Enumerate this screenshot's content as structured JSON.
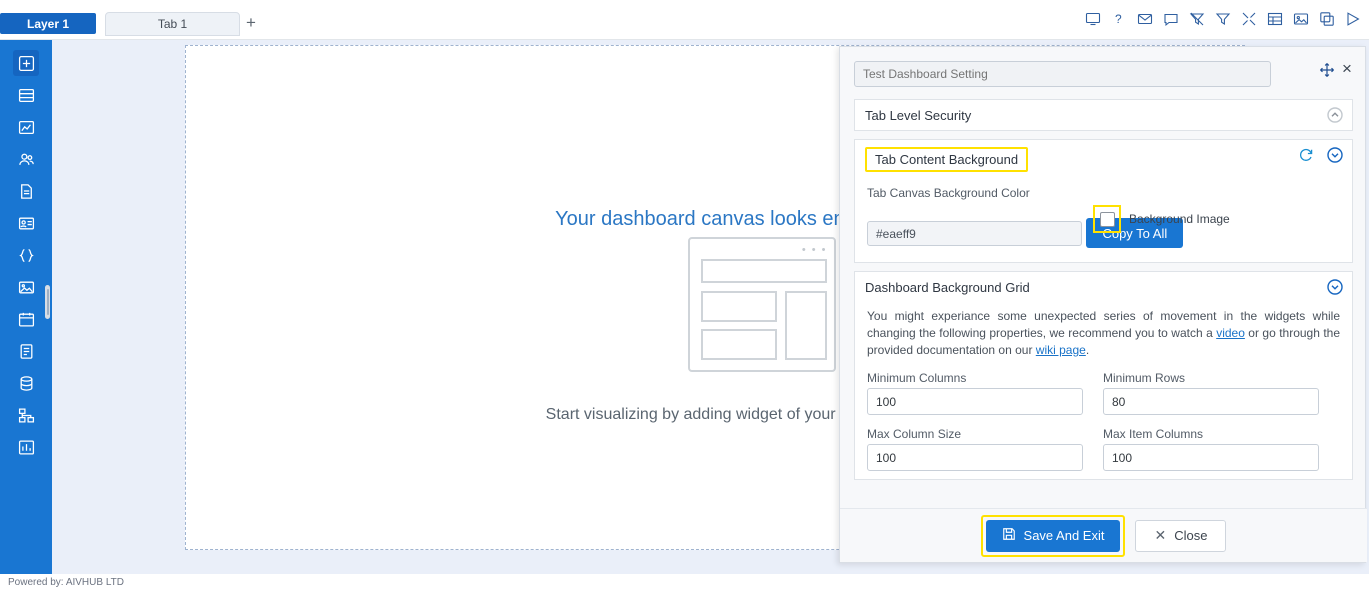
{
  "topbar": {
    "layer_label": "Layer 1",
    "tab_label": "Tab 1",
    "add_tab": "+",
    "icons": [
      {
        "name": "monitor-icon",
        "glyph": "monitor"
      },
      {
        "name": "help-icon",
        "glyph": "?"
      },
      {
        "name": "mail-icon",
        "glyph": "mail"
      },
      {
        "name": "comment-icon",
        "glyph": "comment"
      },
      {
        "name": "filter-off-icon",
        "glyph": "filter-off"
      },
      {
        "name": "filter-icon",
        "glyph": "filter"
      },
      {
        "name": "tools-icon",
        "glyph": "tools"
      },
      {
        "name": "table-icon",
        "glyph": "table"
      },
      {
        "name": "image-icon",
        "glyph": "image"
      },
      {
        "name": "copy-icon",
        "glyph": "copy"
      },
      {
        "name": "play-icon",
        "glyph": "play"
      }
    ]
  },
  "rail": {
    "items": [
      {
        "name": "sidebar-item-dashboard",
        "glyph": "grid-plus",
        "active": true
      },
      {
        "name": "sidebar-item-layout",
        "glyph": "rows"
      },
      {
        "name": "sidebar-item-chart",
        "glyph": "chart"
      },
      {
        "name": "sidebar-item-users",
        "glyph": "users"
      },
      {
        "name": "sidebar-item-document",
        "glyph": "doc"
      },
      {
        "name": "sidebar-item-card",
        "glyph": "card"
      },
      {
        "name": "sidebar-item-code",
        "glyph": "code"
      },
      {
        "name": "sidebar-item-media",
        "glyph": "media"
      },
      {
        "name": "sidebar-item-calendar",
        "glyph": "calendar"
      },
      {
        "name": "sidebar-item-page",
        "glyph": "page"
      },
      {
        "name": "sidebar-item-database",
        "glyph": "database"
      },
      {
        "name": "sidebar-item-tree",
        "glyph": "tree"
      },
      {
        "name": "sidebar-item-analytics",
        "glyph": "analytics"
      }
    ]
  },
  "canvas": {
    "title": "Your dashboard canvas looks empty",
    "subtitle": "Start visualizing by adding widget of your choice",
    "placeholder_dots": "• • •"
  },
  "footer": {
    "powered_by": "Powered by: AIVHUB LTD"
  },
  "panel": {
    "title_placeholder": "Test Dashboard Setting",
    "title_value": "",
    "sections": {
      "tab_level_security": {
        "label": "Tab Level Security"
      },
      "tab_content_background": {
        "label": "Tab Content Background",
        "color_field_label": "Tab Canvas Background Color",
        "color_value": "#eaeff9",
        "background_image_label": "Background Image",
        "background_image_checked": false,
        "copy_to_all_label": "Copy To All"
      },
      "dashboard_background_grid": {
        "label": "Dashboard Background Grid",
        "note_part1": "You might experiance some unexpected series of movement in the widgets while changing the following properties, we recommend you to watch a ",
        "note_link1": "video",
        "note_part2": " or go through the provided documentation on our ",
        "note_link2": "wiki page",
        "note_part3": ".",
        "fields": [
          {
            "label": "Minimum Columns",
            "value": "100"
          },
          {
            "label": "Minimum Rows",
            "value": "80"
          },
          {
            "label": "Max Column Size",
            "value": "100"
          },
          {
            "label": "Max Item Columns",
            "value": "100"
          }
        ]
      }
    },
    "footer": {
      "save_label": "Save And Exit",
      "close_label": "Close"
    }
  },
  "colors": {
    "accent": "#1976d2",
    "highlight": "#ffe100",
    "canvas_bg": "#eaeff9",
    "rail_bg": "#1976d2"
  }
}
